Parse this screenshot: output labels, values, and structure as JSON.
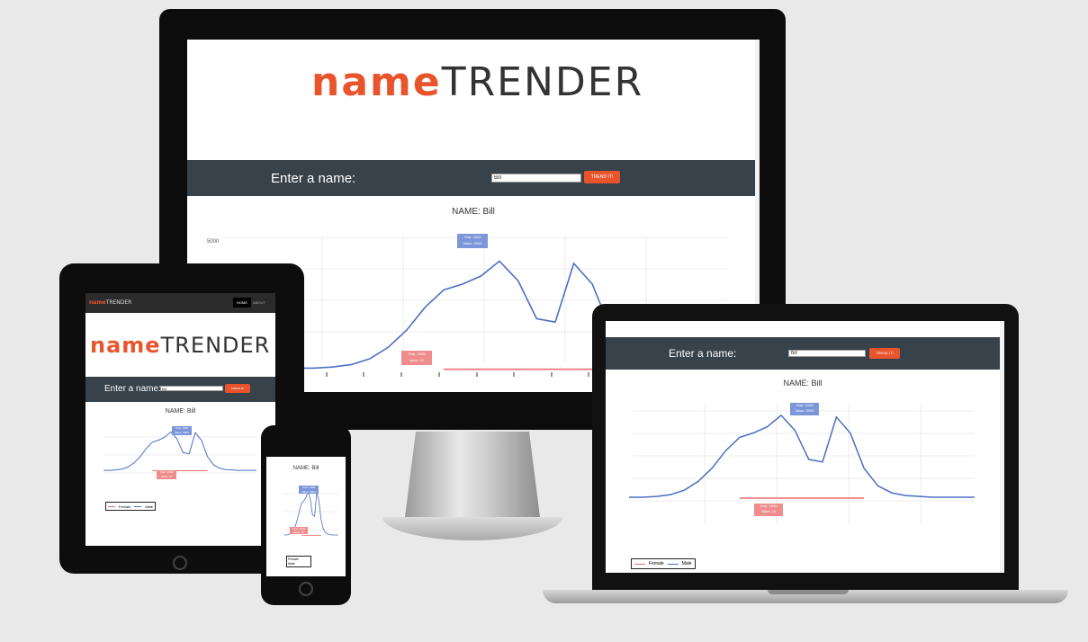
{
  "brand": {
    "word1": "name",
    "word2": "TRENDER"
  },
  "search": {
    "label": "Enter a name:",
    "value": "Bill",
    "button": "TREND IT!"
  },
  "chart": {
    "title": "NAME: Bill",
    "y_tick_top": "5000",
    "male_tooltip_1": "Year: 1946",
    "male_tooltip_2": "Value: 5000",
    "female_tooltip_1": "Year: 1946",
    "female_tooltip_2": "Value: 10",
    "legend_female": "Female",
    "legend_male": "Male",
    "male_color": "#4a6fc4",
    "female_color": "#ef6b6b"
  },
  "tablet_nav": {
    "home": "HOME",
    "about": "ABOUT"
  },
  "chart_data": {
    "type": "line",
    "title": "NAME: Bill",
    "x": [
      0,
      4,
      8,
      12,
      16,
      20,
      24,
      28,
      32,
      36,
      40,
      44,
      48,
      52,
      56,
      60,
      64,
      68,
      72,
      76,
      80,
      84,
      88,
      92,
      96,
      100
    ],
    "series": [
      {
        "name": "Male",
        "values": [
          2,
          2,
          3,
          5,
          10,
          20,
          35,
          55,
          70,
          75,
          82,
          95,
          78,
          45,
          42,
          93,
          75,
          35,
          15,
          7,
          4,
          3,
          2,
          2,
          2,
          2
        ]
      },
      {
        "name": "Female",
        "values": [
          0,
          0,
          0,
          0,
          0,
          0,
          0,
          0,
          1,
          1,
          1,
          1,
          1,
          1,
          1,
          1,
          1,
          1,
          0,
          0,
          0,
          0,
          0,
          0,
          0,
          0
        ]
      }
    ]
  }
}
